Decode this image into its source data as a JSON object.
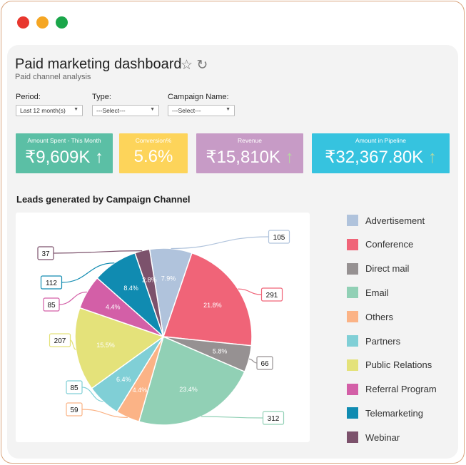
{
  "window": {
    "controls": [
      {
        "name": "close",
        "color": "#e8372e"
      },
      {
        "name": "minimize",
        "color": "#f5a623"
      },
      {
        "name": "maximize",
        "color": "#1aa64a"
      }
    ]
  },
  "header": {
    "title": "Paid marketing dashboard",
    "subtitle": "Paid channel analysis",
    "star_icon": "☆",
    "refresh_icon": "↻"
  },
  "filters": [
    {
      "label": "Period:",
      "value": "Last 12 month(s)"
    },
    {
      "label": "Type:",
      "value": "---Select---"
    },
    {
      "label": "Campaign Name:",
      "value": "---Select---"
    }
  ],
  "kpis": [
    {
      "title": "Amount Spent - This Month",
      "value": "₹9,609K",
      "trend": "↑",
      "color": "#5bbfa5"
    },
    {
      "title": "Conversion%",
      "value": "5.6%",
      "trend": "",
      "color": "#fdd45a"
    },
    {
      "title": "Revenue",
      "value": "₹15,810K",
      "trend": "↑",
      "color": "#c79bc6"
    },
    {
      "title": "Amount in Pipeline",
      "value": "₹32,367.80K",
      "trend": "↑",
      "color": "#36c3df"
    }
  ],
  "chart_data": {
    "type": "pie",
    "title": "Leads generated by Campaign Channel",
    "legend_position": "right",
    "categories": [
      "Advertisement",
      "Conference",
      "Direct mail",
      "Email",
      "Others",
      "Partners",
      "Public Relations",
      "Referral Program",
      "Telemarketing",
      "Webinar"
    ],
    "values": [
      105,
      291,
      66,
      312,
      59,
      85,
      207,
      85,
      112,
      37
    ],
    "percent_labels": [
      "7.9%",
      "21.8%",
      "5.8%",
      "23.4%",
      "4.4%",
      "6.4%",
      "15.5%",
      "4.4%",
      "8.4%",
      "2.8%"
    ],
    "colors": [
      "#b0c3dc",
      "#f06478",
      "#969192",
      "#91d0b5",
      "#fbb386",
      "#80cfd6",
      "#e4e27a",
      "#d35fa7",
      "#108bb1",
      "#7c526c"
    ]
  }
}
